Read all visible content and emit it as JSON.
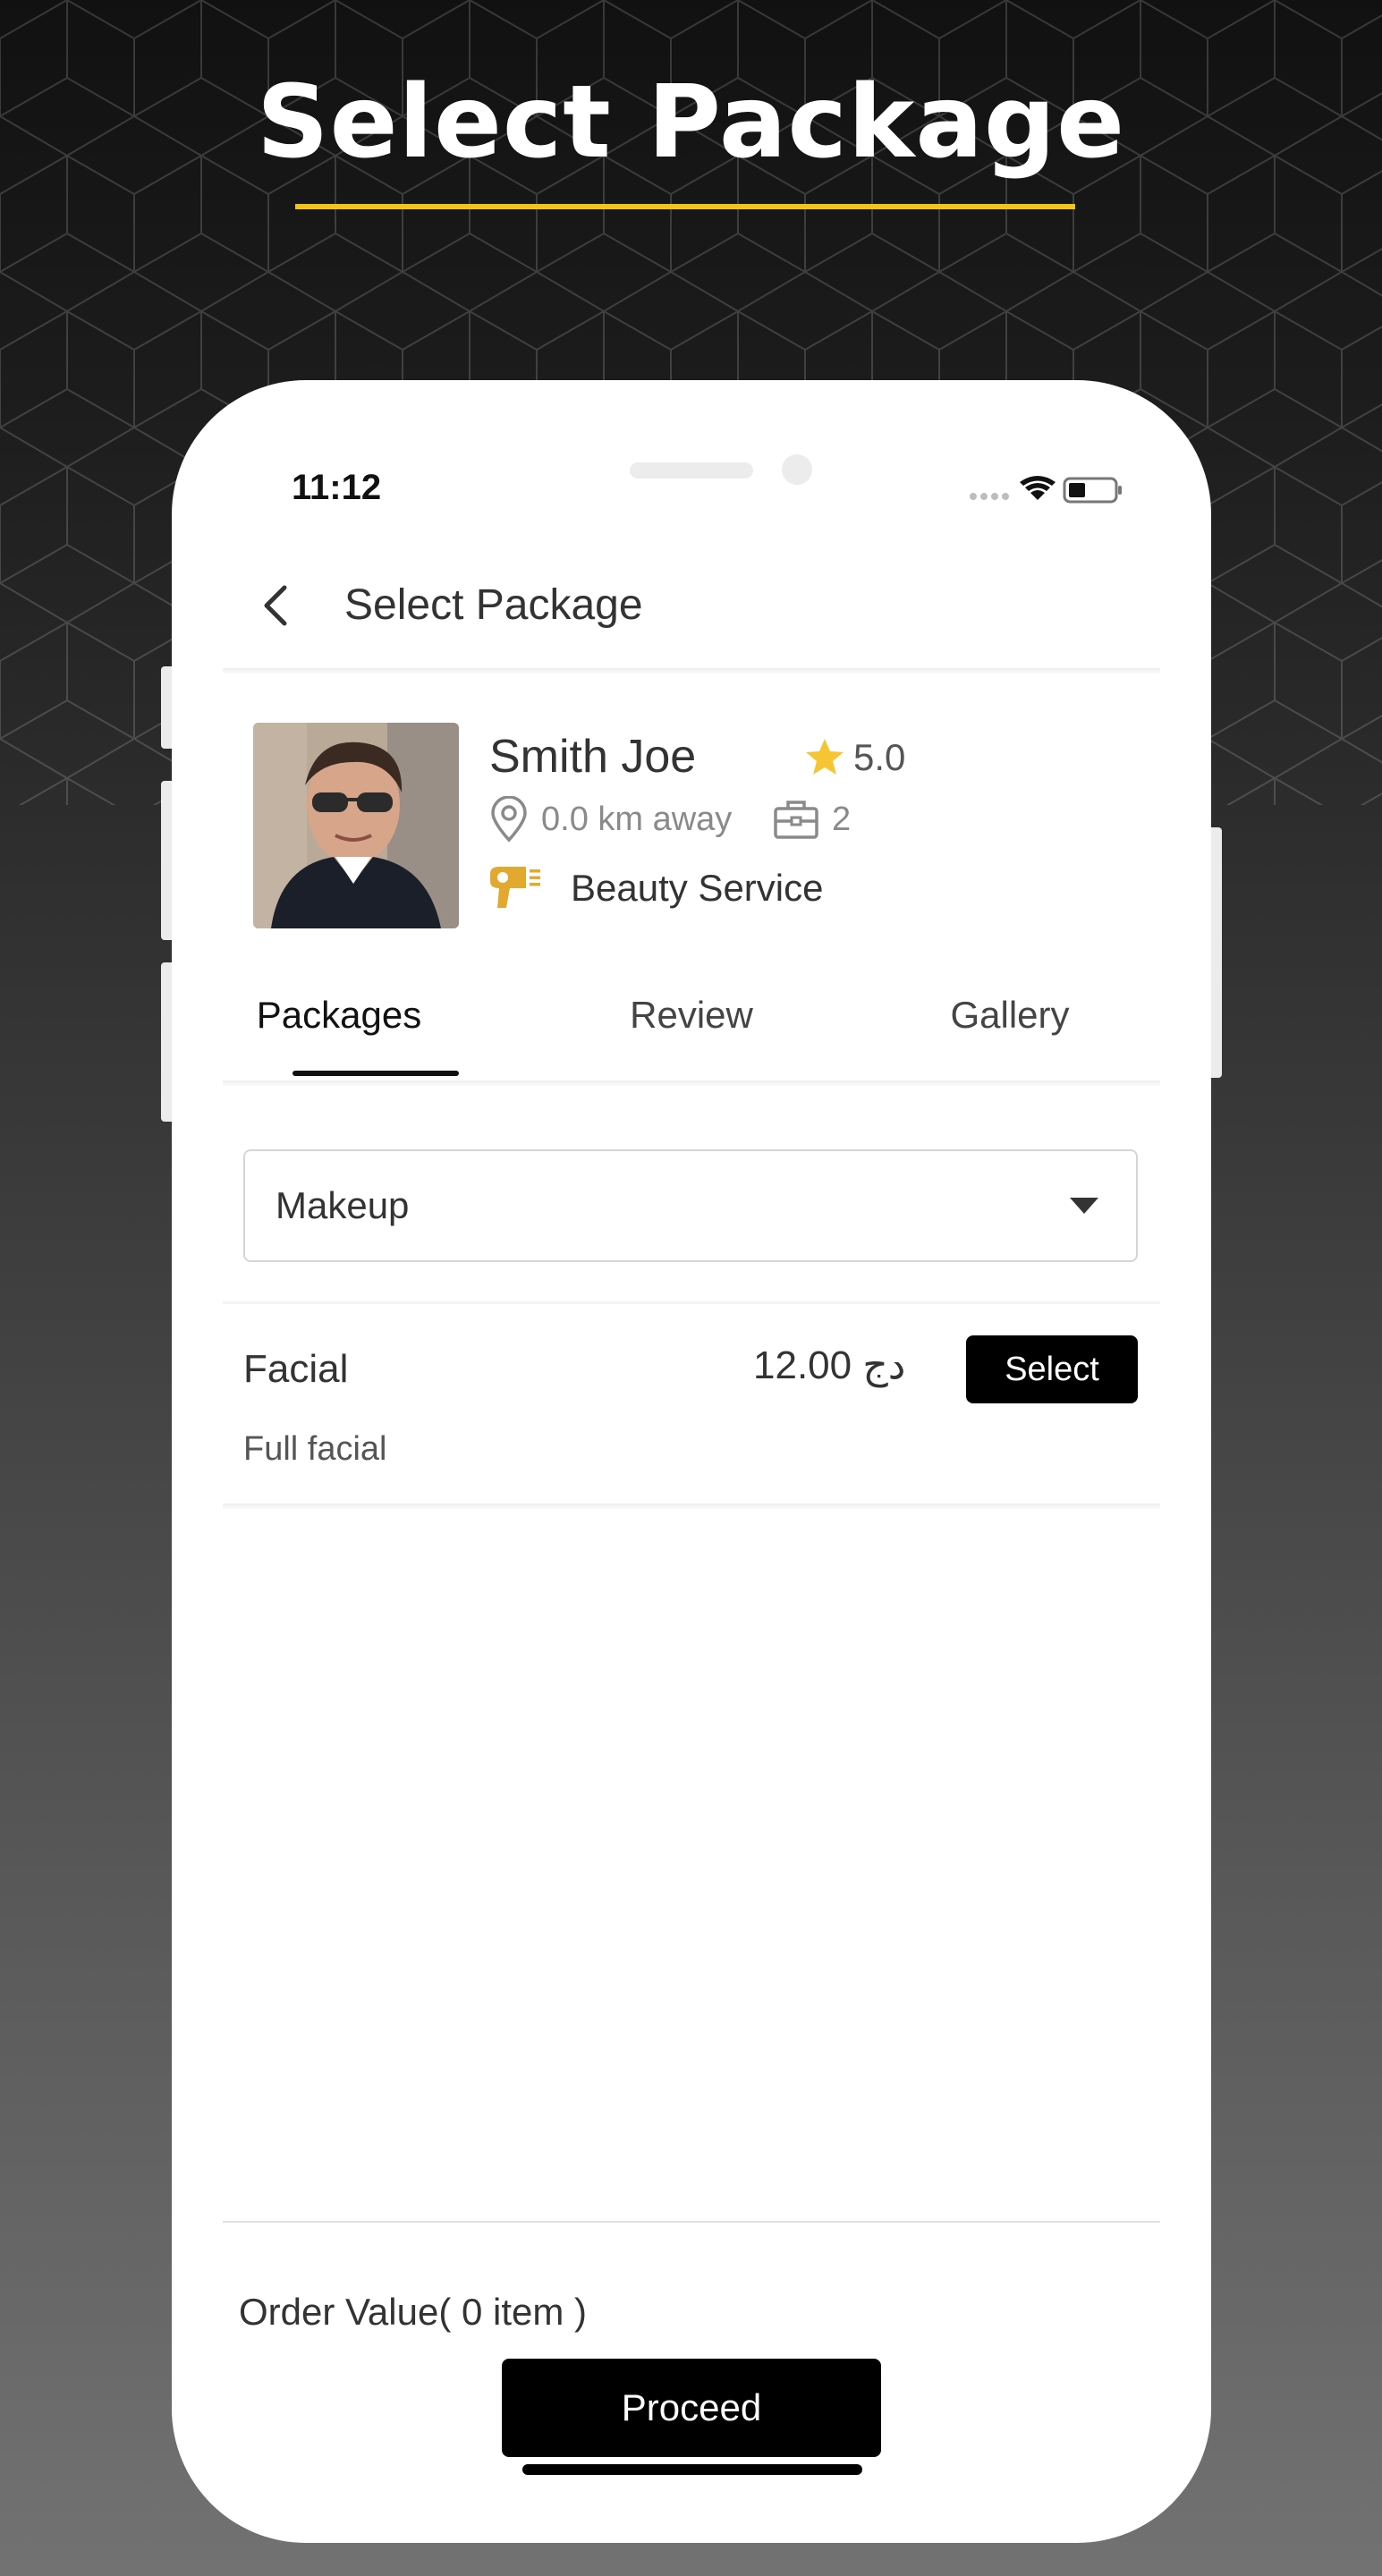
{
  "banner": {
    "title": "Select Package"
  },
  "status_bar": {
    "time": "11:12"
  },
  "nav": {
    "title": "Select Package"
  },
  "provider": {
    "name": "Smith Joe",
    "rating": "5.0",
    "distance": "0.0 km away",
    "jobs": "2",
    "service": "Beauty Service"
  },
  "tabs": [
    {
      "label": "Packages",
      "active": true
    },
    {
      "label": "Review",
      "active": false
    },
    {
      "label": "Gallery",
      "active": false
    }
  ],
  "category_dropdown": {
    "selected": "Makeup"
  },
  "packages": [
    {
      "name": "Facial",
      "price": "12.00 دج",
      "select_label": "Select",
      "description": "Full facial"
    }
  ],
  "footer": {
    "order_value": "Order Value( 0 item )",
    "proceed_label": "Proceed"
  },
  "colors": {
    "accent": "#f2c318",
    "service_icon": "#e3a830",
    "star": "#f5c534",
    "button": "#000000"
  },
  "icons": [
    "back-arrow-icon",
    "star-icon",
    "location-pin-icon",
    "briefcase-icon",
    "hair-dryer-icon",
    "chevron-down-icon",
    "wifi-icon",
    "battery-icon",
    "signal-icon"
  ]
}
